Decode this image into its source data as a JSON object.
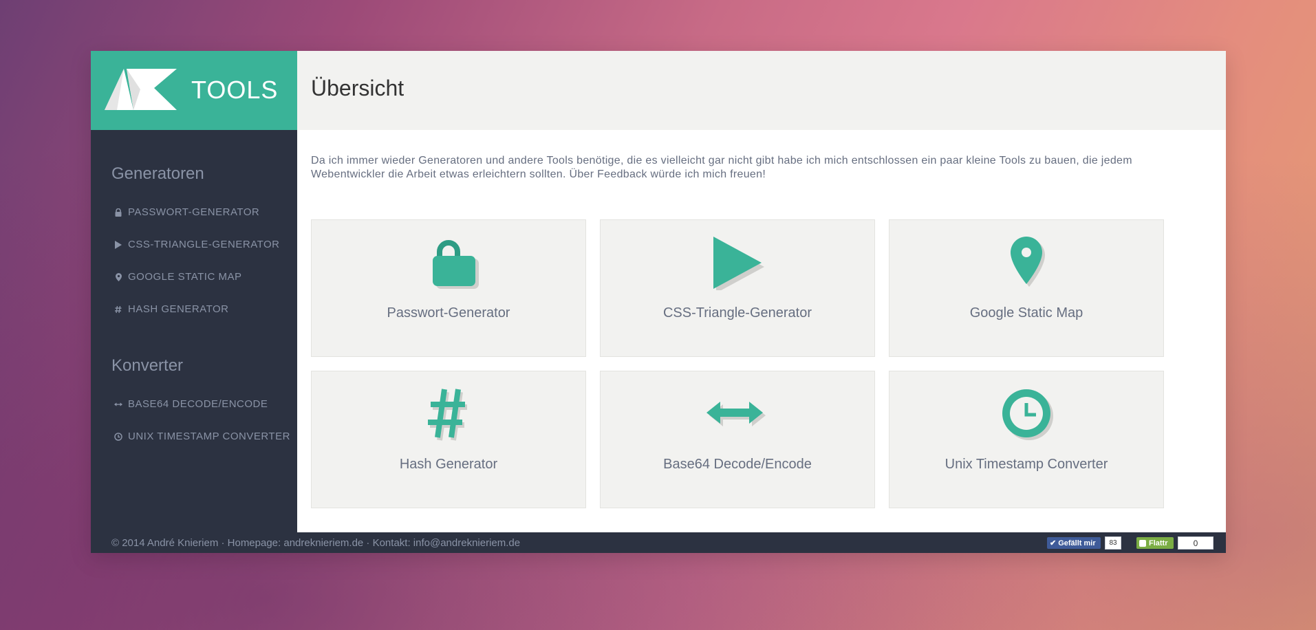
{
  "brand": {
    "logo_text": "TOOLS",
    "accent": "#3ab398"
  },
  "sidebar": {
    "generators_title": "Generatoren",
    "generators": [
      {
        "label": "PASSWORT-GENERATOR",
        "icon": "lock-icon"
      },
      {
        "label": "CSS-TRIANGLE-GENERATOR",
        "icon": "play-icon"
      },
      {
        "label": "GOOGLE STATIC MAP",
        "icon": "map-marker-icon"
      },
      {
        "label": "HASH GENERATOR",
        "icon": "hash-icon"
      }
    ],
    "converters_title": "Konverter",
    "converters": [
      {
        "label": "BASE64 DECODE/ENCODE",
        "icon": "arrows-horizontal-icon"
      },
      {
        "label": "UNIX TIMESTAMP CONVERTER",
        "icon": "clock-icon"
      }
    ]
  },
  "main": {
    "title": "Übersicht",
    "intro": "Da ich immer wieder Generatoren und andere Tools benötige, die es vielleicht gar nicht gibt habe ich mich entschlossen ein paar kleine Tools zu bauen, die jedem Webentwickler die Arbeit etwas erleichtern sollten. Über Feedback würde ich mich freuen!",
    "tiles": [
      {
        "label": "Passwort-Generator",
        "icon": "lock-icon"
      },
      {
        "label": "CSS-Triangle-Generator",
        "icon": "play-icon"
      },
      {
        "label": "Google Static Map",
        "icon": "map-marker-icon"
      },
      {
        "label": "Hash Generator",
        "icon": "hash-icon"
      },
      {
        "label": "Base64 Decode/Encode",
        "icon": "arrows-horizontal-icon"
      },
      {
        "label": "Unix Timestamp Converter",
        "icon": "clock-icon"
      }
    ]
  },
  "footer": {
    "text": "© 2014 André Knieriem · Homepage: andreknieriem.de · Kontakt: info@andreknieriem.de",
    "like_label": "Gefällt mir",
    "like_count": "83",
    "flattr_label": "Flattr",
    "flattr_count": "0"
  }
}
